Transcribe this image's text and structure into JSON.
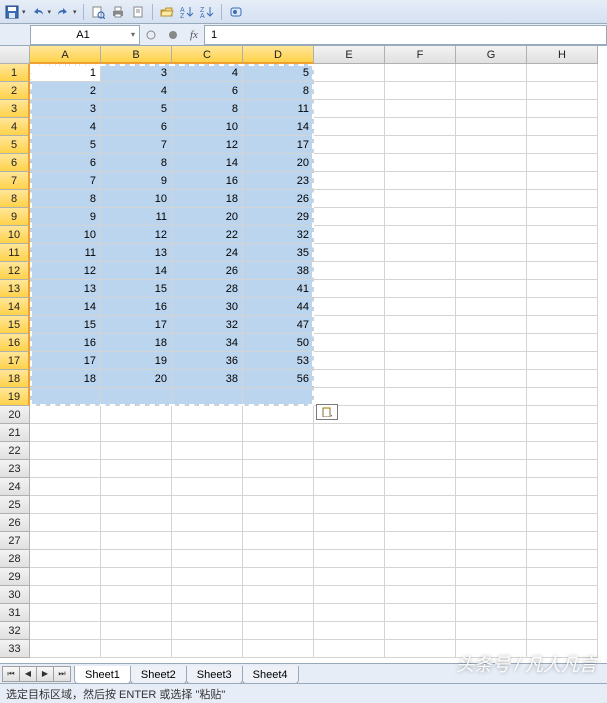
{
  "toolbar": {
    "icons": [
      "save-icon",
      "undo-icon",
      "redo-icon",
      "print-preview-icon",
      "print-icon",
      "page-setup-icon",
      "open-icon",
      "sort-asc-icon",
      "sort-desc-icon",
      "toggle-icon"
    ]
  },
  "name_box": {
    "value": "A1"
  },
  "formula_bar": {
    "fx_label": "fx",
    "value": "1"
  },
  "grid": {
    "columns": [
      "A",
      "B",
      "C",
      "D",
      "E",
      "F",
      "G",
      "H"
    ],
    "visible_rows": 33,
    "selection": {
      "cols": 4,
      "rows": 19,
      "active_row": 0,
      "active_col": 0
    },
    "data": [
      [
        1,
        3,
        4,
        5
      ],
      [
        2,
        4,
        6,
        8
      ],
      [
        3,
        5,
        8,
        11
      ],
      [
        4,
        6,
        10,
        14
      ],
      [
        5,
        7,
        12,
        17
      ],
      [
        6,
        8,
        14,
        20
      ],
      [
        7,
        9,
        16,
        23
      ],
      [
        8,
        10,
        18,
        26
      ],
      [
        9,
        11,
        20,
        29
      ],
      [
        10,
        12,
        22,
        32
      ],
      [
        11,
        13,
        24,
        35
      ],
      [
        12,
        14,
        26,
        38
      ],
      [
        13,
        15,
        28,
        41
      ],
      [
        14,
        16,
        30,
        44
      ],
      [
        15,
        17,
        32,
        47
      ],
      [
        16,
        18,
        34,
        50
      ],
      [
        17,
        19,
        36,
        53
      ],
      [
        18,
        20,
        38,
        56
      ]
    ]
  },
  "sheets": {
    "nav": [
      "⏮",
      "◀",
      "▶",
      "⏭"
    ],
    "tabs": [
      "Sheet1",
      "Sheet2",
      "Sheet3",
      "Sheet4"
    ],
    "active": 0
  },
  "status_bar": {
    "text": "选定目标区域，然后按 ENTER 或选择 \"粘贴\""
  },
  "watermark": {
    "text": "头条号 / 凡人凡言"
  }
}
